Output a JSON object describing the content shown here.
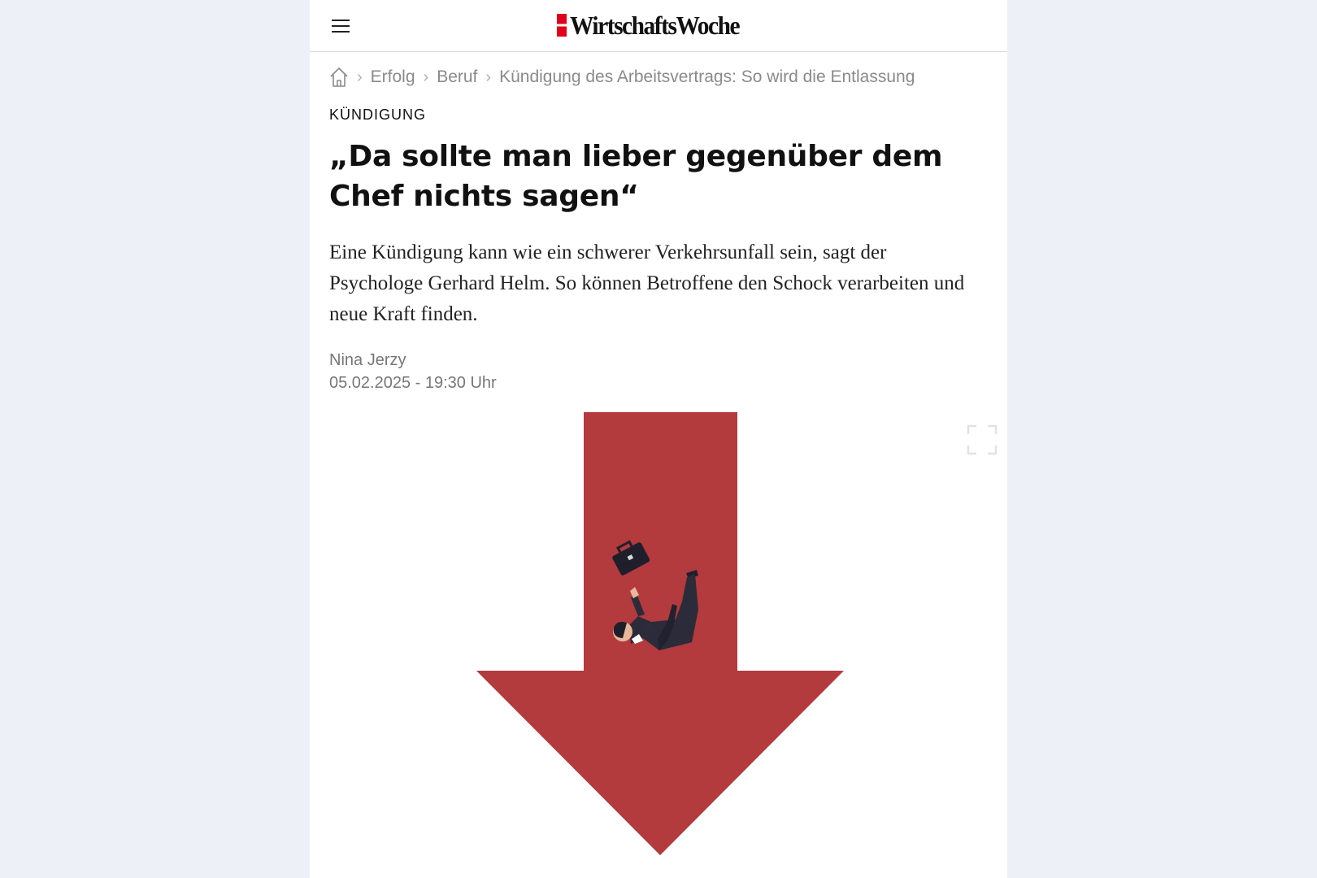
{
  "header": {
    "logo_text": "WirtschaftsWoche",
    "menu_icon": "hamburger-icon"
  },
  "breadcrumb": {
    "home_icon": "home-icon",
    "items": [
      "Erfolg",
      "Beruf",
      "Kündigung des Arbeitsvertrags: So wird die Entlassung"
    ]
  },
  "article": {
    "kicker": "KÜNDIGUNG",
    "headline": "„Da sollte man lieber gegenüber dem Chef nichts sagen“",
    "teaser": "Eine Kündigung kann wie ein schwerer Verkehrsunfall sein, sagt der Psychologe Gerhard Helm. So können Betroffene den Schock verarbeiten und neue Kraft finden.",
    "author": "Nina Jerzy",
    "date": "05.02.2025 - 19:30 Uhr"
  },
  "image": {
    "expand_icon": "expand-icon",
    "arrow_color": "#b33a3d"
  },
  "colors": {
    "brand_red": "#e2001a",
    "background": "#eef0f8"
  }
}
